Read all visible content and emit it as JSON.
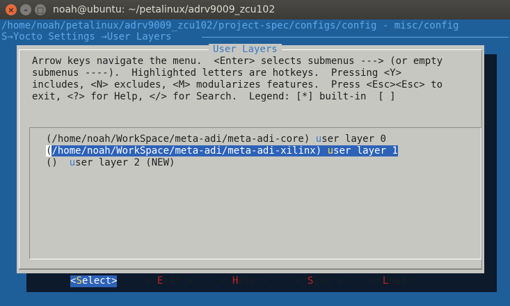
{
  "window": {
    "title": "noah@ubuntu: ~/petalinux/adrv9009_zcu102",
    "close_glyph": "×",
    "minimize_glyph": "–",
    "maximize_glyph": "□"
  },
  "terminal": {
    "path_line": "/home/noah/petalinux/adrv9009_zcu102/project-spec/configs/config - misc/config",
    "breadcrumb_line": "S→Yocto Settings →User Layers "
  },
  "dialog": {
    "title": "User Layers",
    "help_text": "Arrow keys navigate the menu.  <Enter> selects submenus ---> (or empty\nsubmenus ----).  Highlighted letters are hotkeys.  Pressing <Y>\nincludes, <N> excludes, <M> modularizes features.  Press <Esc><Esc> to\nexit, <?> for Help, </> for Search.  Legend: [*] built-in  [ ]",
    "items": [
      {
        "prefix": "(/home/noah/WorkSpace/meta-adi/meta-adi-core) ",
        "hotkey": "u",
        "rest": "ser layer 0",
        "selected": false
      },
      {
        "cursor": "(",
        "prefix": "/home/noah/WorkSpace/meta-adi/meta-adi-xilinx) ",
        "hotkey": "u",
        "rest": "ser layer 1",
        "selected": true
      },
      {
        "prefix": "()  ",
        "hotkey": "u",
        "rest": "ser layer 2 (NEW)",
        "selected": false
      }
    ],
    "buttons": {
      "select": {
        "open": "<",
        "hotkey": "S",
        "rest": "elect>",
        "active": true
      },
      "exit": {
        "open": "< ",
        "hotkey": "E",
        "rest": "xit >",
        "active": false
      },
      "help": {
        "open": "< ",
        "hotkey": "H",
        "rest": "elp >",
        "active": false
      },
      "save": {
        "open": "< ",
        "hotkey": "S",
        "rest": "ave >",
        "active": false
      },
      "load": {
        "open": "< ",
        "hotkey": "L",
        "rest": "oad >",
        "active": false
      }
    }
  },
  "colors": {
    "terminal_bg": "#1f5f99",
    "dialog_bg": "#c7c7c2",
    "highlight": "#2d62b8",
    "hotkey_button": "#c2241c",
    "hotkey_selected": "#ffe04a"
  }
}
